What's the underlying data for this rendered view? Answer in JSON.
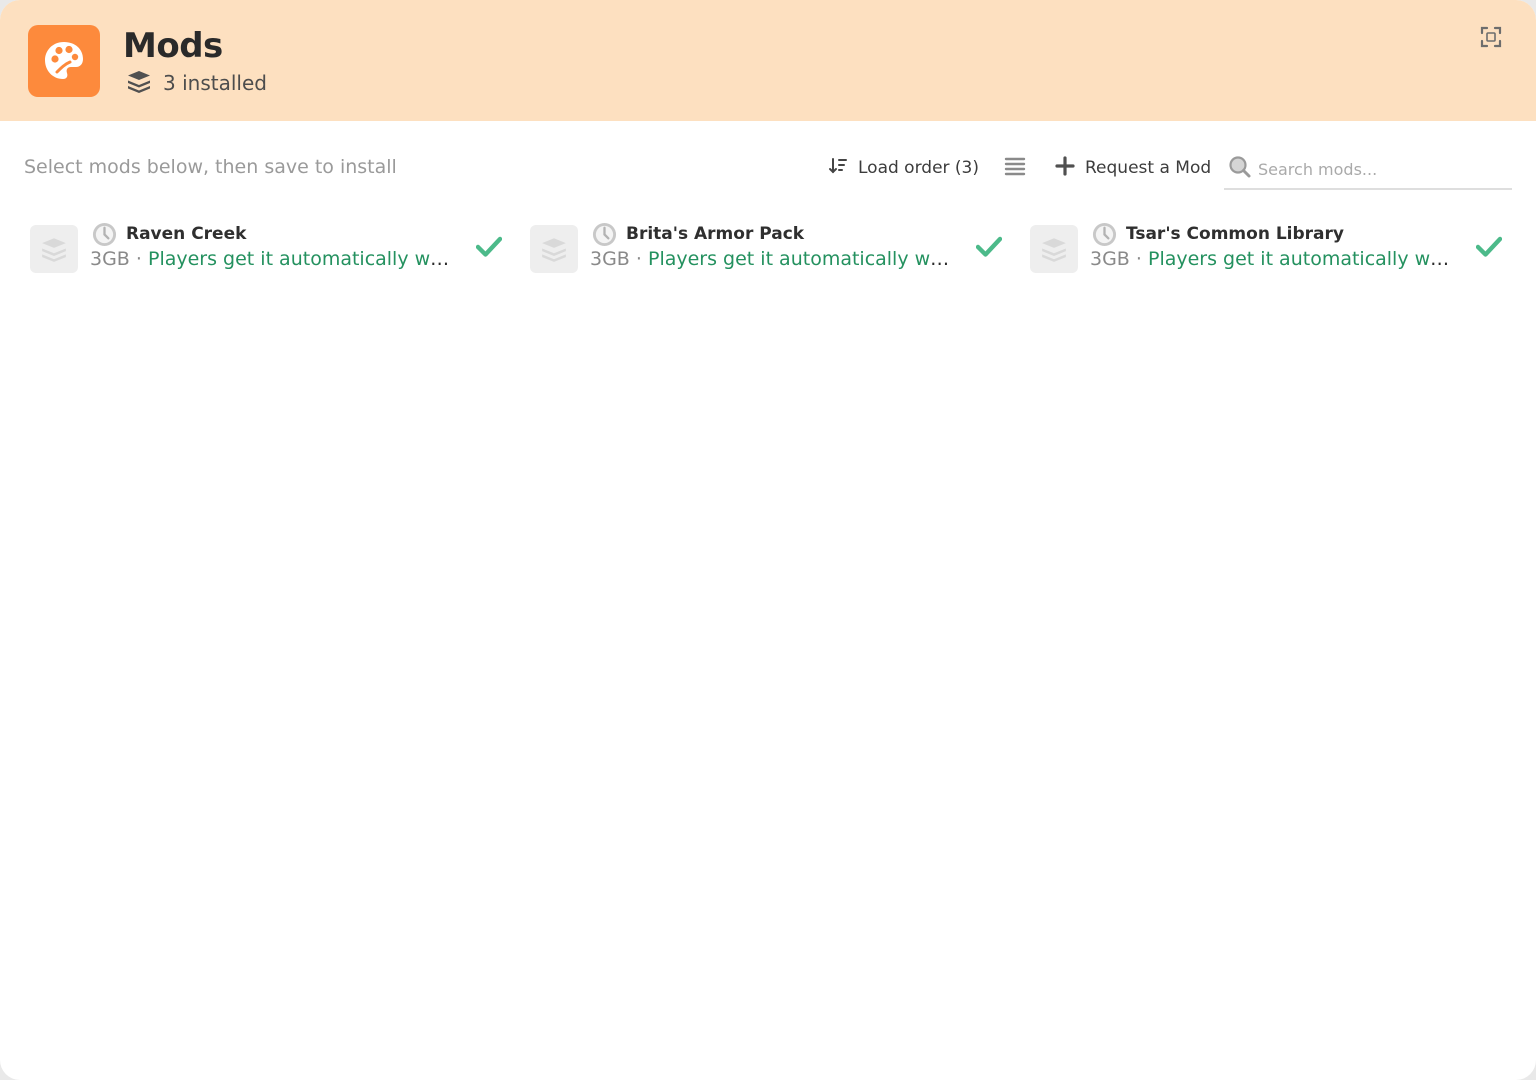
{
  "header": {
    "title": "Mods",
    "installed_text": "3 installed",
    "accent_color": "#fd8a3c",
    "background_color": "#fde0c0",
    "icons": {
      "app": "palette-icon",
      "installed": "layers-icon",
      "fullscreen": "expand-icon"
    }
  },
  "toolbar": {
    "hint": "Select mods below, then save to install",
    "load_order_label": "Load order (3)",
    "request_mod_label": "Request a Mod",
    "search_placeholder": "Search mods...",
    "icons": {
      "load_order": "sort-icon",
      "list_toggle": "list-icon",
      "request": "plus-icon",
      "search": "search-icon"
    }
  },
  "mods": [
    {
      "name": "Raven Creek",
      "size": "3GB",
      "separator": " · ",
      "note": "Players get it automatically when they join",
      "selected": true
    },
    {
      "name": "Brita's Armor Pack",
      "size": "3GB",
      "separator": " · ",
      "note": "Players get it automatically when they join",
      "selected": true
    },
    {
      "name": "Tsar's Common Library",
      "size": "3GB",
      "separator": " · ",
      "note": "Players get it automatically when they join",
      "selected": true
    }
  ],
  "colors": {
    "note_green": "#24915f",
    "check_green": "#4cba8a",
    "muted": "#9a9a9a"
  }
}
